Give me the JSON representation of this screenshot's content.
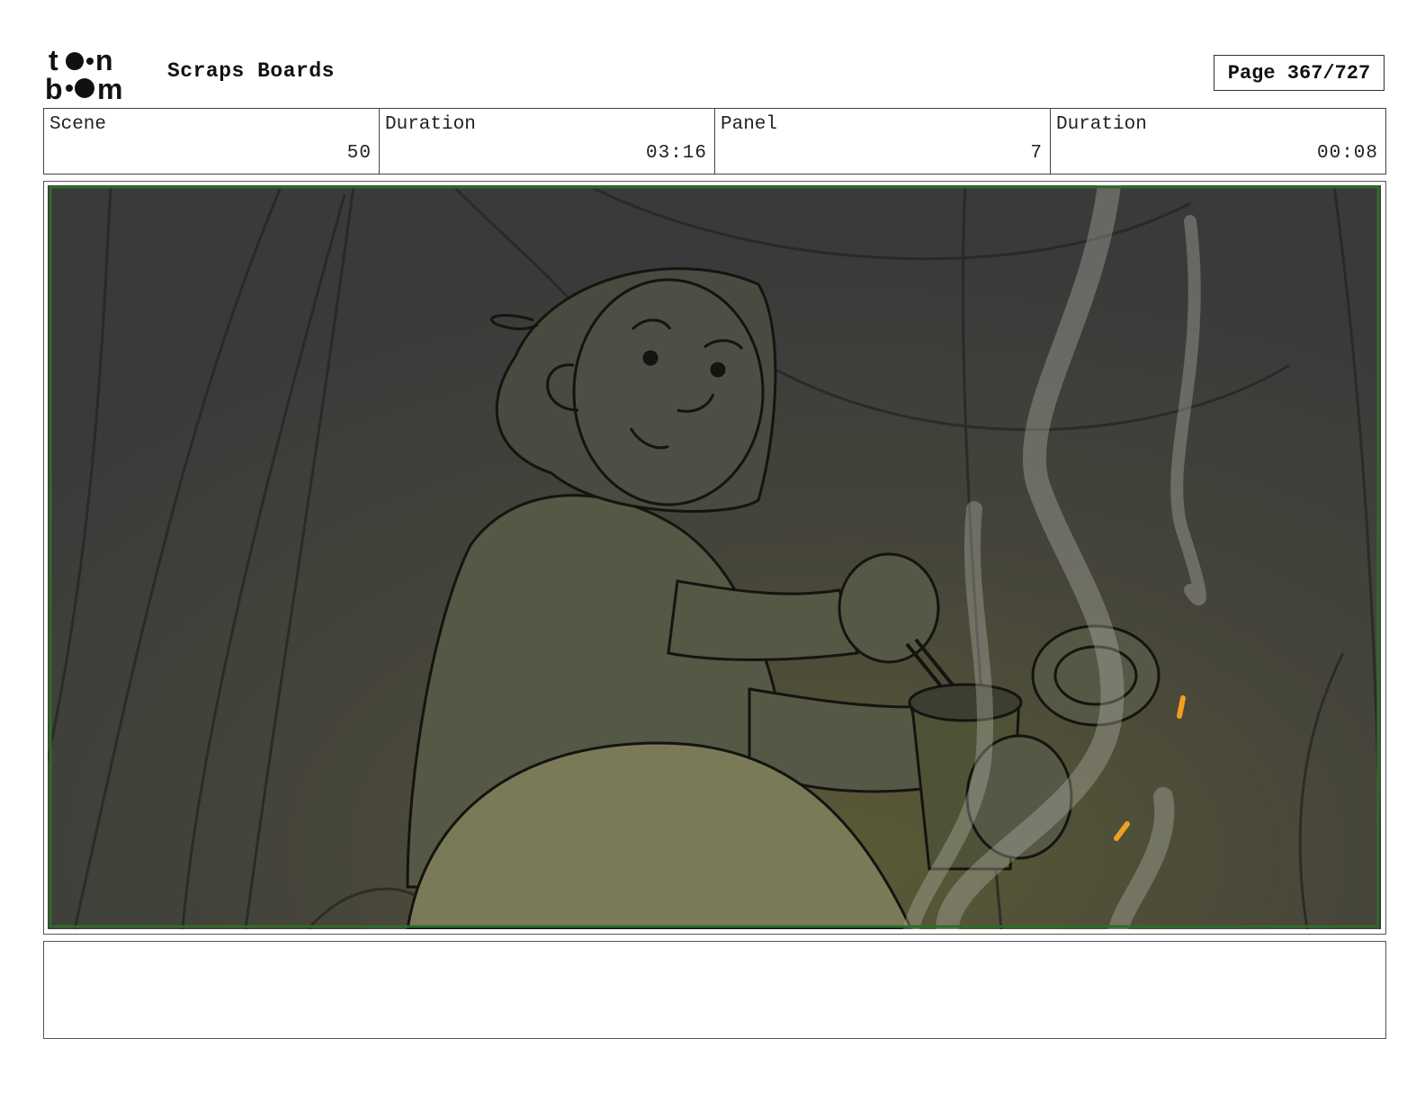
{
  "header": {
    "logo_text": "toon boom",
    "project_title": "Scraps Boards",
    "page_label": "Page 367/727"
  },
  "info": {
    "scene_label": "Scene",
    "scene_value": "50",
    "scene_duration_label": "Duration",
    "scene_duration_value": "03:16",
    "panel_label": "Panel",
    "panel_value": "7",
    "panel_duration_label": "Duration",
    "panel_duration_value": "00:08"
  },
  "panel": {
    "image_description": "storyboard sketch"
  },
  "notes": {
    "text": ""
  },
  "colors": {
    "safe_frame": "#2f6b2a",
    "ember": "#f0a020",
    "bg_dark": "#3a3a3a",
    "bg_warm": "#4d4d36"
  }
}
